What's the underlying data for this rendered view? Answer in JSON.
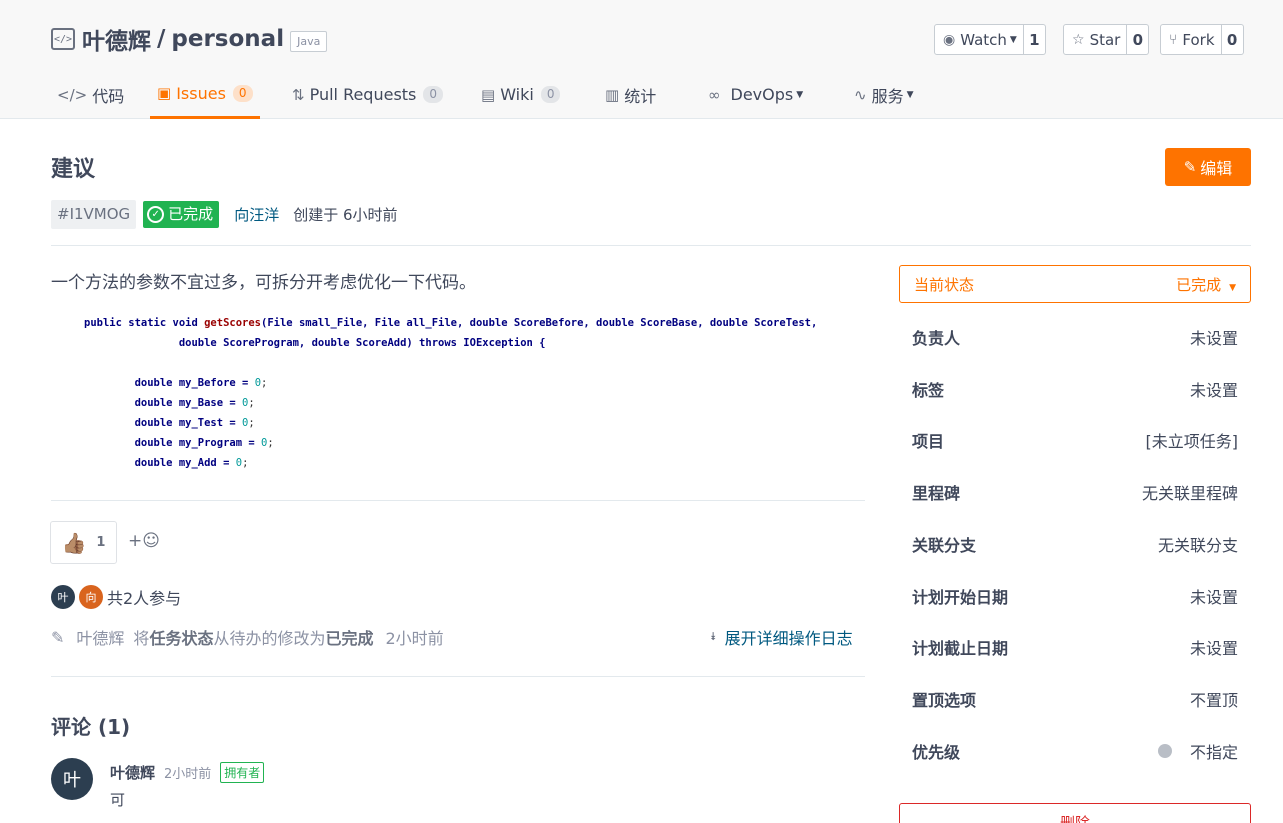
{
  "repo": {
    "owner": "叶德辉",
    "separator": "/",
    "name": "personal",
    "language": "Java"
  },
  "social": {
    "watch_label": "Watch",
    "watch_count": "1",
    "star_label": "Star",
    "star_count": "0",
    "fork_label": "Fork",
    "fork_count": "0"
  },
  "tabs": [
    {
      "label": "代码",
      "icon": "code-icon"
    },
    {
      "label": "Issues",
      "count": "0",
      "icon": "issues-icon",
      "active": true
    },
    {
      "label": "Pull Requests",
      "count": "0",
      "icon": "pull-request-icon"
    },
    {
      "label": "Wiki",
      "count": "0",
      "icon": "wiki-icon"
    },
    {
      "label": "统计",
      "icon": "stats-icon"
    },
    {
      "label": "DevOps",
      "icon": "infinity-icon"
    },
    {
      "label": "服务",
      "icon": "pulse-icon"
    }
  ],
  "issue": {
    "title": "建议",
    "edit_label": "编辑",
    "id": "#I1VMOG",
    "status": "已完成",
    "author": "向汪洋",
    "created": "创建于 6小时前",
    "description": "一个方法的参数不宜过多，可拆分开考虑优化一下代码。"
  },
  "code": {
    "line1_a": "public static void ",
    "line1_fn": "getScores",
    "line1_b": "(File small_File, File all_File, double ScoreBefore, double ScoreBase, double ScoreTest,",
    "line2": "double ScoreProgram, double ScoreAdd) throws IOException {",
    "vars": [
      {
        "decl": "double my_Before = ",
        "val": "0",
        "end": ";"
      },
      {
        "decl": "double my_Base = ",
        "val": "0",
        "end": ";"
      },
      {
        "decl": "double my_Test = ",
        "val": "0",
        "end": ";"
      },
      {
        "decl": "double my_Program = ",
        "val": "0",
        "end": ";"
      },
      {
        "decl": "double my_Add = ",
        "val": "0",
        "end": ";"
      }
    ]
  },
  "reaction": {
    "emoji": "👍🏽",
    "count": "1",
    "add": "+☺"
  },
  "participants": {
    "avatar1": "叶",
    "avatar2": "向",
    "text": "共2人参与"
  },
  "oplog": {
    "author": "叶德辉",
    "pre": "将",
    "field": "任务状态",
    "mid": "从待办的修改为",
    "value": "已完成",
    "time": "2小时前",
    "expand_label": "展开详细操作日志"
  },
  "comments": {
    "title": "评论 (1)",
    "items": [
      {
        "avatar": "叶",
        "author": "叶德辉",
        "time": "2小时前",
        "badge": "拥有者",
        "body": "可"
      }
    ]
  },
  "sidebar": {
    "state_label": "当前状态",
    "state_value": "已完成",
    "rows": [
      {
        "label": "负责人",
        "value": "未设置"
      },
      {
        "label": "标签",
        "value": "未设置"
      },
      {
        "label": "项目",
        "value": "[未立项任务]"
      },
      {
        "label": "里程碑",
        "value": "无关联里程碑"
      },
      {
        "label": "关联分支",
        "value": "无关联分支"
      },
      {
        "label": "计划开始日期",
        "value": "未设置"
      },
      {
        "label": "计划截止日期",
        "value": "未设置"
      },
      {
        "label": "置顶选项",
        "value": "不置顶"
      },
      {
        "label": "优先级",
        "value": "不指定"
      }
    ],
    "delete_label": "删除"
  },
  "colors": {
    "accent": "#fe7300",
    "success": "#21b351",
    "link": "#005980",
    "danger": "#db2828"
  }
}
